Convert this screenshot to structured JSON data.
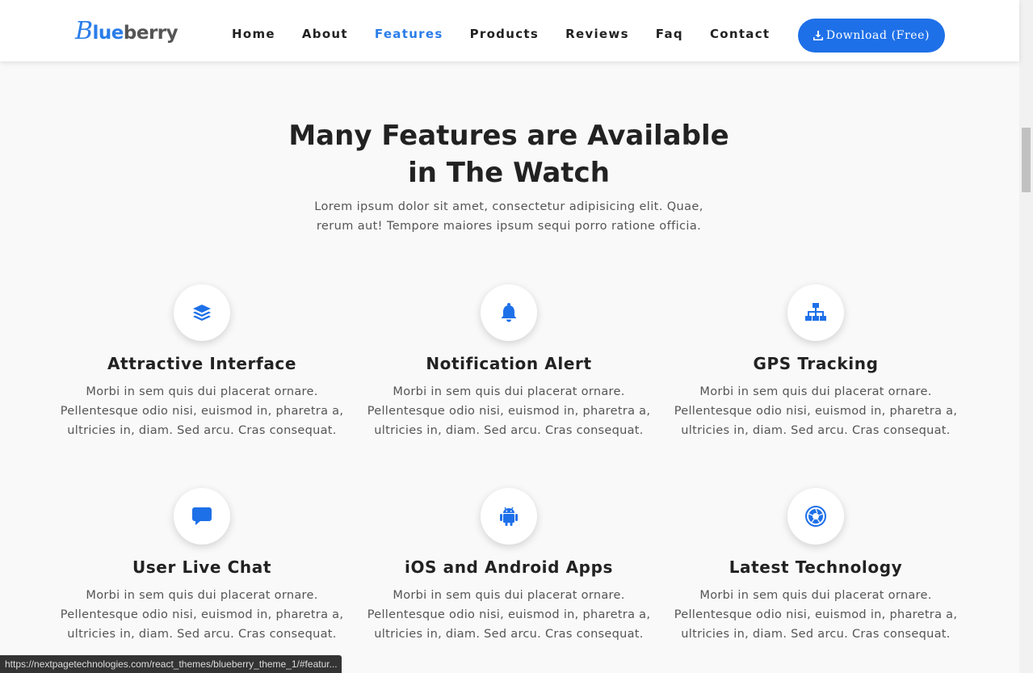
{
  "brand": {
    "logo_initial": "B",
    "logo_mid": "lue",
    "logo_rest": "berry",
    "accent_color": "#2b7de9"
  },
  "nav": {
    "items": [
      {
        "label": "Home",
        "active": false
      },
      {
        "label": "About",
        "active": false
      },
      {
        "label": "Features",
        "active": true
      },
      {
        "label": "Products",
        "active": false
      },
      {
        "label": "Reviews",
        "active": false
      },
      {
        "label": "Faq",
        "active": false
      },
      {
        "label": "Contact",
        "active": false
      }
    ],
    "download_label": "Download (Free)",
    "download_icon": "download-icon"
  },
  "section": {
    "title_line1": "Many Features are Available",
    "title_line2": "in The Watch",
    "subtitle": "Lorem ipsum dolor sit amet, consectetur adipisicing elit. Quae, rerum aut! Tempore maiores ipsum sequi porro ratione officia."
  },
  "features": [
    {
      "icon": "layers-icon",
      "title": "Attractive Interface",
      "desc": "Morbi in sem quis dui placerat ornare. Pellentesque odio nisi, euismod in, pharetra a, ultricies in, diam. Sed arcu. Cras consequat."
    },
    {
      "icon": "bell-icon",
      "title": "Notification Alert",
      "desc": "Morbi in sem quis dui placerat ornare. Pellentesque odio nisi, euismod in, pharetra a, ultricies in, diam. Sed arcu. Cras consequat."
    },
    {
      "icon": "sitemap-icon",
      "title": "GPS Tracking",
      "desc": "Morbi in sem quis dui placerat ornare. Pellentesque odio nisi, euismod in, pharetra a, ultricies in, diam. Sed arcu. Cras consequat."
    },
    {
      "icon": "chat-icon",
      "title": "User Live Chat",
      "desc": "Morbi in sem quis dui placerat ornare. Pellentesque odio nisi, euismod in, pharetra a, ultricies in, diam. Sed arcu. Cras consequat."
    },
    {
      "icon": "android-icon",
      "title": "iOS and Android Apps",
      "desc": "Morbi in sem quis dui placerat ornare. Pellentesque odio nisi, euismod in, pharetra a, ultricies in, diam. Sed arcu. Cras consequat."
    },
    {
      "icon": "aperture-icon",
      "title": "Latest Technology",
      "desc": "Morbi in sem quis dui placerat ornare. Pellentesque odio nisi, euismod in, pharetra a, ultricies in, diam. Sed arcu. Cras consequat."
    }
  ],
  "status_bar": {
    "url": "https://nextpagetechnologies.com/react_themes/blueberry_theme_1/#featur..."
  }
}
